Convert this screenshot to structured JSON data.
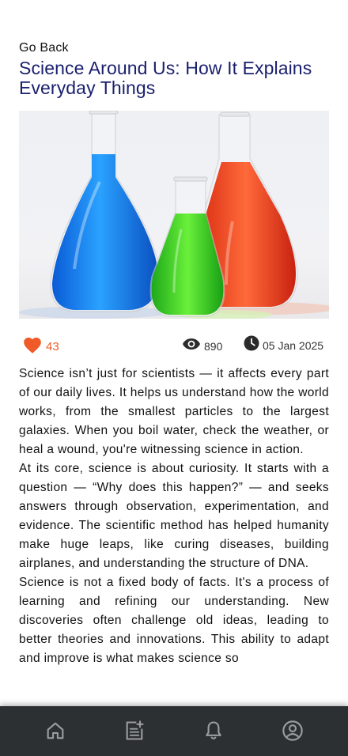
{
  "nav": {
    "go_back_label": "Go Back"
  },
  "article": {
    "title": "Science Around Us: How It Explains Everyday Things",
    "likes": "43",
    "views": "890",
    "date": "05 Jan 2025",
    "paragraphs": [
      "Science isn’t just for scientists — it affects every part of our daily lives. It helps us understand how the world works, from the smallest particles to the largest galaxies. When you boil water, check the weather, or heal a wound, you're witnessing science in action.",
      "At its core, science is about curiosity. It starts with a question — “Why does this happen?” — and seeks answers through observation, experimentation, and evidence. The scientific method has helped humanity make huge leaps, like curing diseases, building airplanes, and understanding the structure of DNA.",
      "Science is not a fixed body of facts. It's a process of learning and refining our understanding. New discoveries often challenge old ideas, leading to better theories and innovations. This ability to adapt and improve is what makes science so"
    ]
  },
  "icons": {
    "like": "heart-icon",
    "views": "eye-icon",
    "date": "clock-icon",
    "nav": [
      "home-icon",
      "news-icon",
      "bell-icon",
      "profile-icon"
    ]
  },
  "colors": {
    "title": "#1a1f6e",
    "like": "#f05a28",
    "nav_bg": "#2d3033",
    "nav_icon": "#9a9da2"
  }
}
